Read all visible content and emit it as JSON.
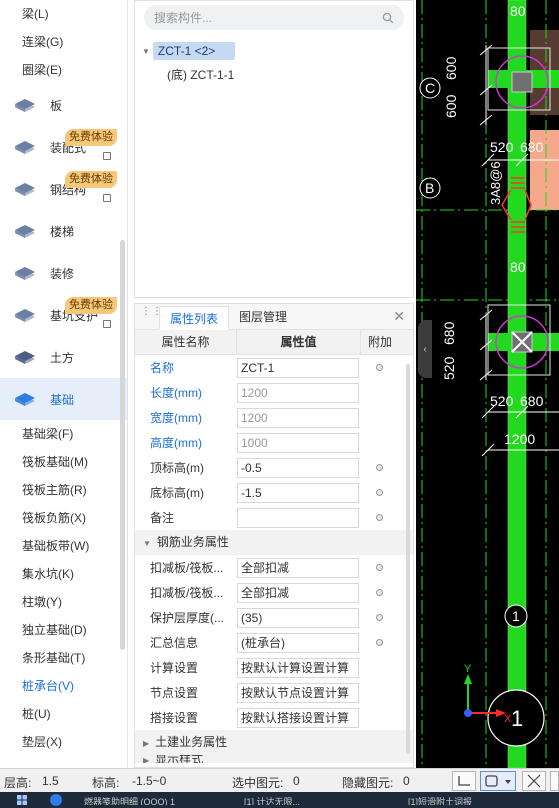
{
  "left_nav": {
    "top_sub_items": [
      "梁(L)",
      "连梁(G)",
      "圈梁(E)"
    ],
    "categories": [
      {
        "label": "板",
        "icon": "slab-icon",
        "badge": "",
        "locked": false
      },
      {
        "label": "装配式",
        "icon": "prefab-icon",
        "badge": "免费体验",
        "locked": true
      },
      {
        "label": "钢结构",
        "icon": "steel-structure-icon",
        "badge": "免费体验",
        "locked": true
      },
      {
        "label": "楼梯",
        "icon": "stairs-icon",
        "badge": "",
        "locked": false
      },
      {
        "label": "装修",
        "icon": "decoration-icon",
        "badge": "",
        "locked": false
      },
      {
        "label": "基坑支护",
        "icon": "foundation-pit-icon",
        "badge": "免费体验",
        "locked": true
      },
      {
        "label": "土方",
        "icon": "earthwork-icon",
        "badge": "",
        "locked": false
      },
      {
        "label": "基础",
        "icon": "foundation-icon",
        "badge": "",
        "locked": false,
        "active": true
      }
    ],
    "foundation_sub_items": [
      "基础梁(F)",
      "筏板基础(M)",
      "筏板主筋(R)",
      "筏板负筋(X)",
      "基础板带(W)",
      "集水坑(K)",
      "柱墩(Y)",
      "独立基础(D)",
      "条形基础(T)",
      "桩承台(V)",
      "桩(U)",
      "垫层(X)"
    ],
    "active_sub_item": "桩承台(V)"
  },
  "tree": {
    "search_placeholder": "搜索构件...",
    "root_label": "ZCT-1 <2>",
    "child_label": "(底) ZCT-1-1"
  },
  "properties": {
    "tabs": [
      "属性列表",
      "图层管理"
    ],
    "active_tab": "属性列表",
    "columns": {
      "name": "属性名称",
      "value": "属性值",
      "extra": "附加"
    },
    "rows": [
      {
        "name": "名称",
        "value": "ZCT-1",
        "blue": true,
        "grey": false,
        "dot": true
      },
      {
        "name": "长度(mm)",
        "value": "1200",
        "blue": true,
        "grey": true,
        "dot": false
      },
      {
        "name": "宽度(mm)",
        "value": "1200",
        "blue": true,
        "grey": true,
        "dot": false
      },
      {
        "name": "高度(mm)",
        "value": "1000",
        "blue": true,
        "grey": true,
        "dot": false
      },
      {
        "name": "顶标高(m)",
        "value": "-0.5",
        "blue": false,
        "grey": false,
        "dot": true
      },
      {
        "name": "底标高(m)",
        "value": "-1.5",
        "blue": false,
        "grey": false,
        "dot": true
      },
      {
        "name": "备注",
        "value": "",
        "blue": false,
        "grey": false,
        "dot": true
      }
    ],
    "section_rebar": "钢筋业务属性",
    "rebar_rows": [
      {
        "name": "扣减板/筏板...",
        "value": "全部扣减",
        "dot": true
      },
      {
        "name": "扣减板/筏板...",
        "value": "全部扣减",
        "dot": true
      },
      {
        "name": "保护层厚度(...",
        "value": "(35)",
        "dot": true
      },
      {
        "name": "汇总信息",
        "value": "(桩承台)",
        "dot": true
      },
      {
        "name": "计算设置",
        "value": "按默认计算设置计算",
        "dot": false
      },
      {
        "name": "节点设置",
        "value": "按默认节点设置计算",
        "dot": false
      },
      {
        "name": "搭接设置",
        "value": "按默认搭接设置计算",
        "dot": false
      }
    ],
    "section_civil": "土建业务属性",
    "section_display": "显示样式"
  },
  "canvas": {
    "dims": [
      "80",
      "600",
      "600",
      "520",
      "680",
      "80",
      "680",
      "520",
      "520",
      "680",
      "1200"
    ],
    "rebar_label": "3A8@6",
    "axis_c": "C",
    "axis_b": "B",
    "axis_1": "1",
    "axis_label_1": "1",
    "axis_y": "Y",
    "axis_x": "X"
  },
  "status_bar": {
    "floor_height_label": "层高:",
    "floor_height_value": "1.5",
    "elevation_label": "标高:",
    "elevation_value": "-1.5~0",
    "selected_label": "选中图元:",
    "selected_value": "0",
    "hidden_label": "隐藏图元:",
    "hidden_value": "0"
  },
  "taskbar": {
    "items": [
      "燃器笺助明细 (OOO) 1",
      "[1] 计达无限...",
      "[1]短滑附土词报"
    ]
  },
  "colors": {
    "accent": "#1d6fd8",
    "canvas_bg": "#000000",
    "green": "#22d91f",
    "salmon": "#f5a98a"
  }
}
